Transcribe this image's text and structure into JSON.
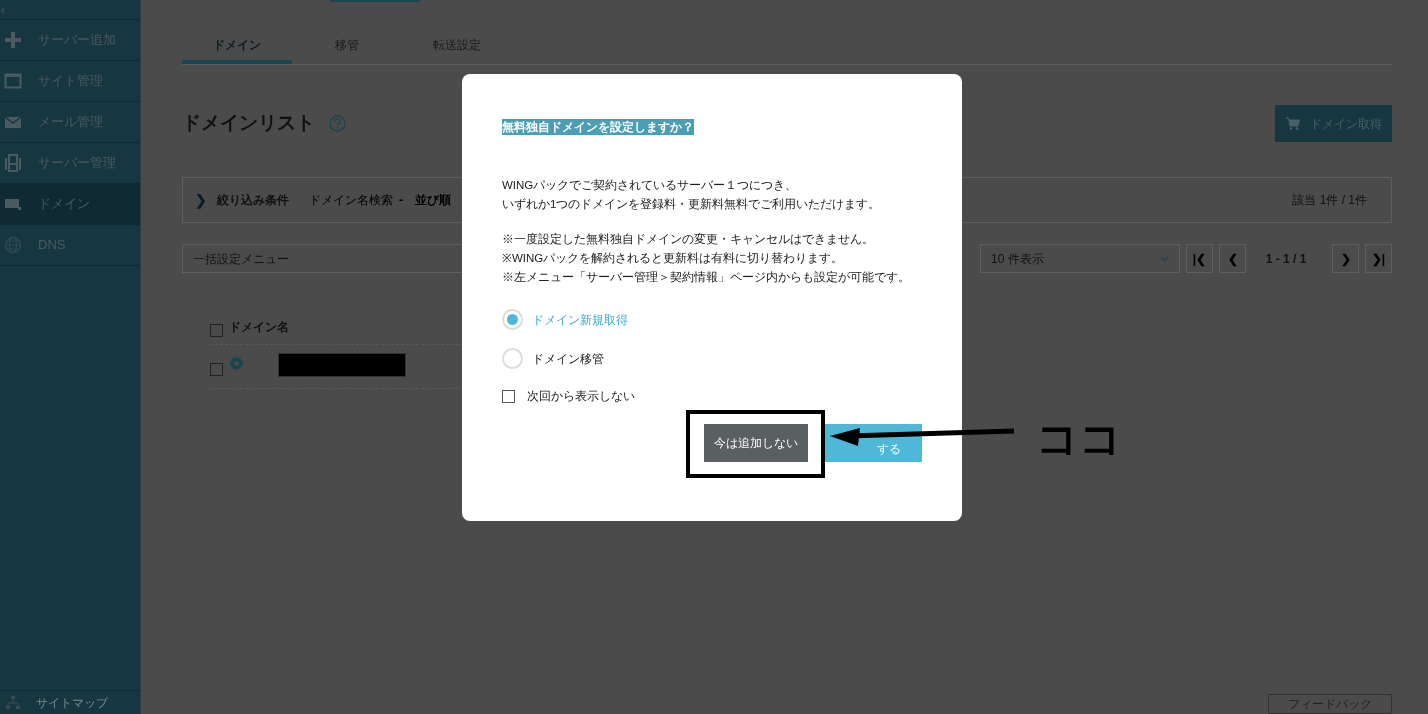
{
  "sidebar": {
    "collapse": "‹",
    "items": [
      {
        "label": "サーバー追加",
        "selected": false
      },
      {
        "label": "サイト管理",
        "selected": false
      },
      {
        "label": "メール管理",
        "selected": false
      },
      {
        "label": "サーバー管理",
        "selected": false
      },
      {
        "label": "ドメイン",
        "selected": true
      },
      {
        "label": "DNS",
        "selected": false
      }
    ],
    "footer": "サイトマップ"
  },
  "tabs": [
    {
      "label": "ドメイン",
      "selected": true
    },
    {
      "label": "移管",
      "selected": false
    },
    {
      "label": "転送設定",
      "selected": false
    }
  ],
  "heading": "ドメインリスト",
  "get_button": "ドメイン取得",
  "filter": {
    "expand": "❯",
    "label": "絞り込み条件",
    "search": "ドメイン名検索",
    "search_value": "-",
    "sort": "並び順",
    "count": "該当 1件 / 1件"
  },
  "bulk_menu": "一括設定メニュー",
  "per_page": "10 件表示",
  "pagination": {
    "first": "|❮",
    "prev": "❮",
    "range": "1 - 1 / 1",
    "next": "❯",
    "last": "❯|"
  },
  "table": {
    "columns": [
      "ドメイン名"
    ],
    "select_all_checked": false,
    "rows": [
      {
        "checked": false
      }
    ]
  },
  "feedback": "フィードバック",
  "dialog": {
    "title": "無料独自ドメインを設定しますか？",
    "paragraphs": [
      [
        "WINGパックでご契約されているサーバー１つにつき、",
        "いずれか1つのドメインを登録料・更新料無料でご利用いただけます。"
      ],
      [
        "※一度設定した無料独自ドメインの変更・キャンセルはできません。",
        "※WINGパックを解約されると更新料は有料に切り替わります。",
        "※左メニュー「サーバー管理＞契約情報」ページ内からも設定が可能です。"
      ]
    ],
    "options": [
      {
        "label": "ドメイン新規取得",
        "selected": true
      },
      {
        "label": "ドメイン移管",
        "selected": false
      }
    ],
    "dont_show": {
      "label": "次回から表示しない",
      "checked": false
    },
    "buttons": [
      {
        "label": "今は追加しない",
        "kind": "secondary"
      },
      {
        "label": "する",
        "kind": "primary"
      }
    ]
  },
  "annotation": {
    "label": "ココ"
  }
}
